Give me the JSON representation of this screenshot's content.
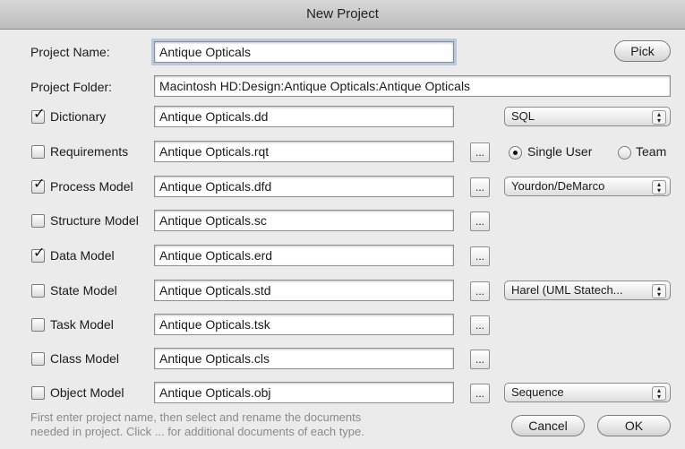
{
  "window": {
    "title": "New Project"
  },
  "project_name": {
    "label": "Project Name:",
    "value": "Antique Opticals"
  },
  "pick_button": "Pick",
  "project_folder": {
    "label": "Project Folder:",
    "value": "Macintosh HD:Design:Antique Opticals:Antique Opticals"
  },
  "documents": [
    {
      "label": "Dictionary",
      "checked": true,
      "file": "Antique Opticals.dd",
      "has_more": false
    },
    {
      "label": "Requirements",
      "checked": false,
      "file": "Antique Opticals.rqt",
      "has_more": true
    },
    {
      "label": "Process Model",
      "checked": true,
      "file": "Antique Opticals.dfd",
      "has_more": true
    },
    {
      "label": "Structure Model",
      "checked": false,
      "file": "Antique Opticals.sc",
      "has_more": true
    },
    {
      "label": "Data Model",
      "checked": true,
      "file": "Antique Opticals.erd",
      "has_more": true
    },
    {
      "label": "State Model",
      "checked": false,
      "file": "Antique Opticals.std",
      "has_more": true
    },
    {
      "label": "Task Model",
      "checked": false,
      "file": "Antique Opticals.tsk",
      "has_more": true
    },
    {
      "label": "Class Model",
      "checked": false,
      "file": "Antique Opticals.cls",
      "has_more": true
    },
    {
      "label": "Object Model",
      "checked": false,
      "file": "Antique Opticals.obj",
      "has_more": true
    }
  ],
  "more_label": "...",
  "dictionary_type": "SQL",
  "user_mode": {
    "single": "Single User",
    "team": "Team",
    "selected": "single"
  },
  "process_method": "Yourdon/DeMarco",
  "state_method": "Harel (UML Statech...",
  "object_method": "Sequence",
  "help": {
    "line1": "First enter project name, then select and rename the documents",
    "line2": "needed in project.  Click ... for additional documents of each type."
  },
  "cancel_button": "Cancel",
  "ok_button": "OK"
}
